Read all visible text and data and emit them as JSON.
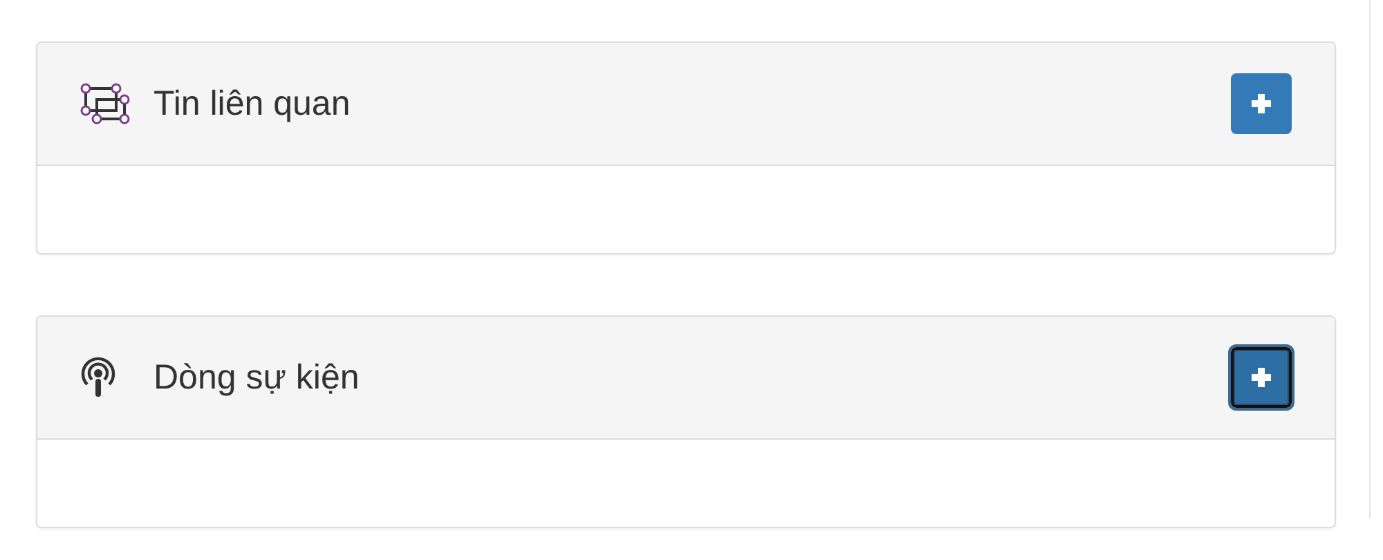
{
  "panels": [
    {
      "title": "Tin liên quan",
      "kind": "nodes",
      "add_button": {
        "focused": false
      }
    },
    {
      "title": "Dòng sự kiện",
      "kind": "podcast",
      "add_button": {
        "focused": true
      }
    }
  ]
}
